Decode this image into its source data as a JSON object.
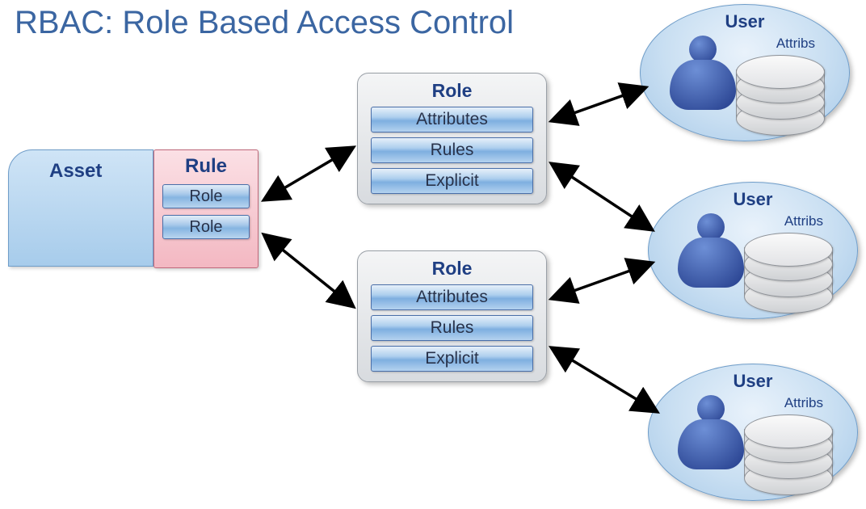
{
  "title": "RBAC: Role Based Access Control",
  "asset": {
    "label": "Asset"
  },
  "rule": {
    "label": "Rule",
    "roles": [
      "Role",
      "Role"
    ]
  },
  "role_panels": [
    {
      "title": "Role",
      "items": [
        "Attributes",
        "Rules",
        "Explicit"
      ]
    },
    {
      "title": "Role",
      "items": [
        "Attributes",
        "Rules",
        "Explicit"
      ]
    }
  ],
  "users": [
    {
      "label": "User",
      "attribs": "Attribs"
    },
    {
      "label": "User",
      "attribs": "Attribs"
    },
    {
      "label": "User",
      "attribs": "Attribs"
    }
  ]
}
